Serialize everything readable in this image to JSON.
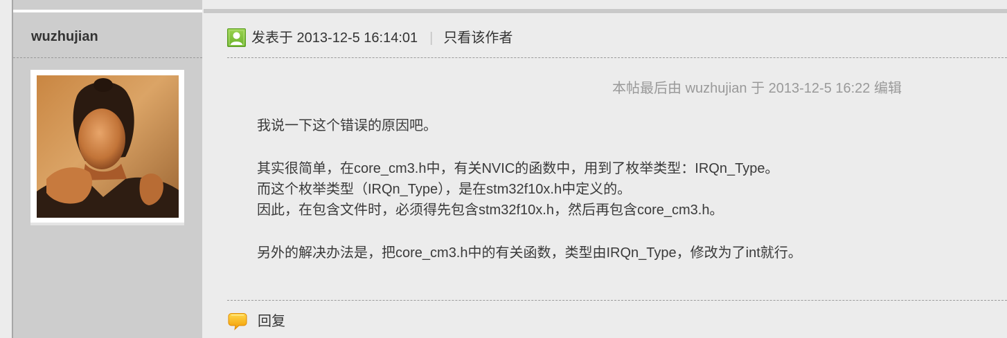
{
  "author": {
    "username": "wuzhujian"
  },
  "post": {
    "meta": {
      "posted_at": "发表于 2013-12-5 16:14:01",
      "separator": "|",
      "only_author_link": "只看该作者"
    },
    "edit_note": "本帖最后由 wuzhujian 于 2013-12-5 16:22 编辑",
    "paragraphs": [
      {
        "lines": [
          "我说一下这个错误的原因吧。"
        ]
      },
      {
        "lines": [
          "其实很简单，在core_cm3.h中，有关NVIC的函数中，用到了枚举类型：IRQn_Type。",
          "而这个枚举类型（IRQn_Type），是在stm32f10x.h中定义的。",
          "因此，在包含文件时，必须得先包含stm32f10x.h，然后再包含core_cm3.h。"
        ]
      },
      {
        "lines": [
          "另外的解决办法是，把core_cm3.h中的有关函数，类型由IRQn_Type，修改为了int就行。"
        ]
      }
    ]
  },
  "actions": {
    "reply_label": "回复"
  },
  "icons": {
    "online_status": "user-online-icon",
    "reply": "reply-bubble-icon"
  },
  "colors": {
    "page_bg": "#ececec",
    "sidebar_bg": "#cdcdcd",
    "text": "#333333",
    "muted_text": "#999999"
  }
}
